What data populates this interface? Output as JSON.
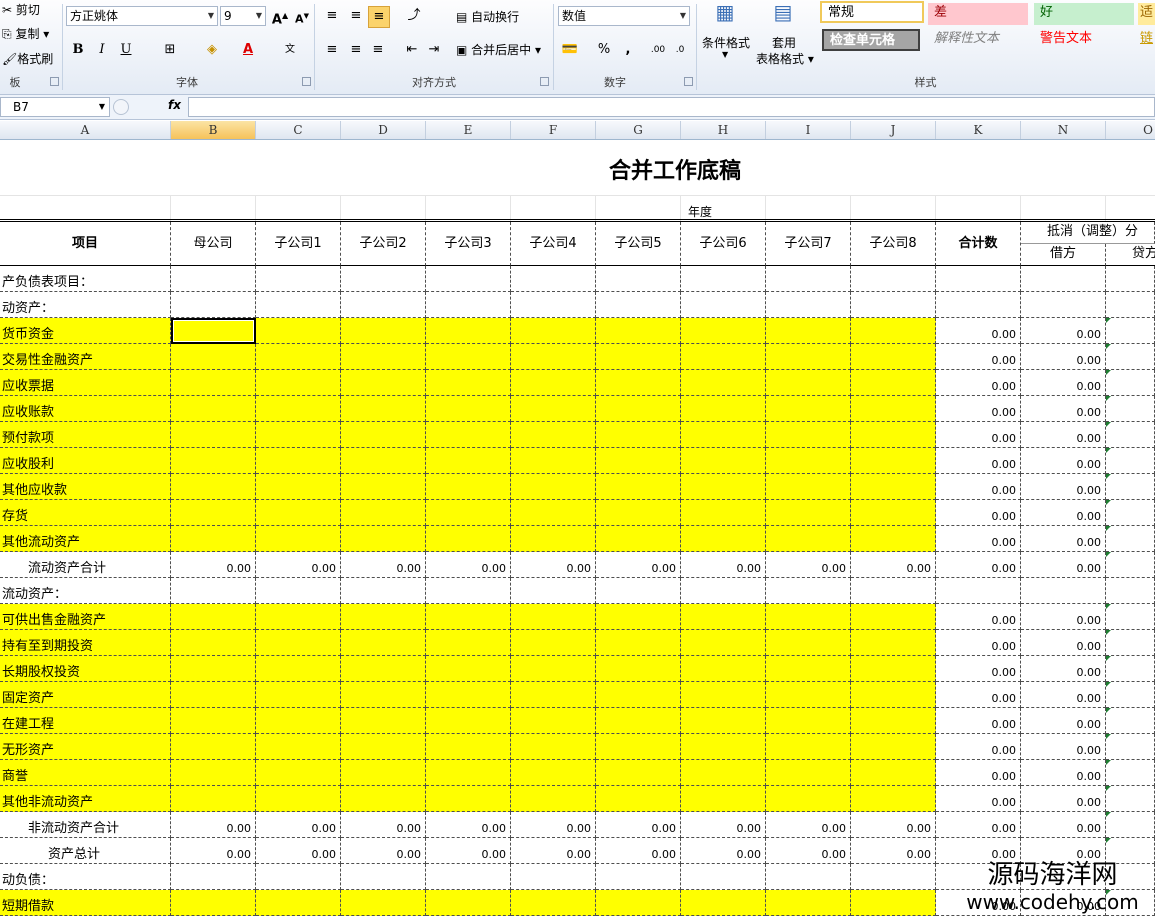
{
  "ribbon": {
    "clipboard": {
      "cut": "剪切",
      "copy": "复制",
      "painter": "格式刷",
      "label": "板"
    },
    "font": {
      "name": "方正姚体",
      "size": "9",
      "label": "字体",
      "bold": "B",
      "italic": "I",
      "underline": "U"
    },
    "alignment": {
      "wrap": "自动换行",
      "merge": "合并后居中",
      "label": "对齐方式"
    },
    "number": {
      "format": "数值",
      "percent": "%",
      "comma": ",",
      "label": "数字"
    },
    "styles": {
      "conditional": "条件格式",
      "table1": "套用",
      "table2": "表格格式",
      "normal": "常规",
      "bad": "差",
      "good": "好",
      "neutral": "适",
      "check": "检查单元格",
      "explain": "解释性文本",
      "warning": "警告文本",
      "link": "链",
      "label": "样式"
    }
  },
  "formula_bar": {
    "cell_ref": "B7",
    "fx": "fx",
    "value": ""
  },
  "columns": [
    "A",
    "B",
    "C",
    "D",
    "E",
    "F",
    "G",
    "H",
    "I",
    "J",
    "K",
    "N",
    "O"
  ],
  "sheet": {
    "title": "合并工作底稿",
    "year_label": "年度",
    "header": {
      "item": "项目",
      "companies": [
        "母公司",
        "子公司1",
        "子公司2",
        "子公司3",
        "子公司4",
        "子公司5",
        "子公司6",
        "子公司7",
        "子公司8"
      ],
      "total": "合计数",
      "offset": "抵消（调整）分",
      "debit": "借方",
      "credit": "贷方"
    },
    "rows": [
      {
        "label": "产负债表项目：",
        "type": "section"
      },
      {
        "label": "动资产：",
        "type": "section"
      },
      {
        "label": "货币资金",
        "type": "input"
      },
      {
        "label": "交易性金融资产",
        "type": "input"
      },
      {
        "label": "应收票据",
        "type": "input"
      },
      {
        "label": "应收账款",
        "type": "input"
      },
      {
        "label": "预付款项",
        "type": "input"
      },
      {
        "label": "应收股利",
        "type": "input"
      },
      {
        "label": "其他应收款",
        "type": "input"
      },
      {
        "label": "存货",
        "type": "input"
      },
      {
        "label": "其他流动资产",
        "type": "input"
      },
      {
        "label": "流动资产合计",
        "type": "subtotal",
        "indent": 1
      },
      {
        "label": "流动资产：",
        "type": "section"
      },
      {
        "label": "可供出售金融资产",
        "type": "input"
      },
      {
        "label": "持有至到期投资",
        "type": "input"
      },
      {
        "label": "长期股权投资",
        "type": "input"
      },
      {
        "label": "固定资产",
        "type": "input"
      },
      {
        "label": "在建工程",
        "type": "input"
      },
      {
        "label": "无形资产",
        "type": "input"
      },
      {
        "label": "商誉",
        "type": "input"
      },
      {
        "label": "其他非流动资产",
        "type": "input"
      },
      {
        "label": "非流动资产合计",
        "type": "subtotal",
        "indent": 1
      },
      {
        "label": "资产总计",
        "type": "subtotal",
        "indent": 2
      },
      {
        "label": "动负债：",
        "type": "section"
      },
      {
        "label": "短期借款",
        "type": "input"
      }
    ],
    "zero": "0.00"
  },
  "watermark": {
    "line1": "源码海洋网",
    "line2": "www.codehy.com"
  },
  "colors": {
    "input_fill": "#ffff00",
    "selected_header": "#f6c25a",
    "grid_line": "#4f4f4f"
  }
}
